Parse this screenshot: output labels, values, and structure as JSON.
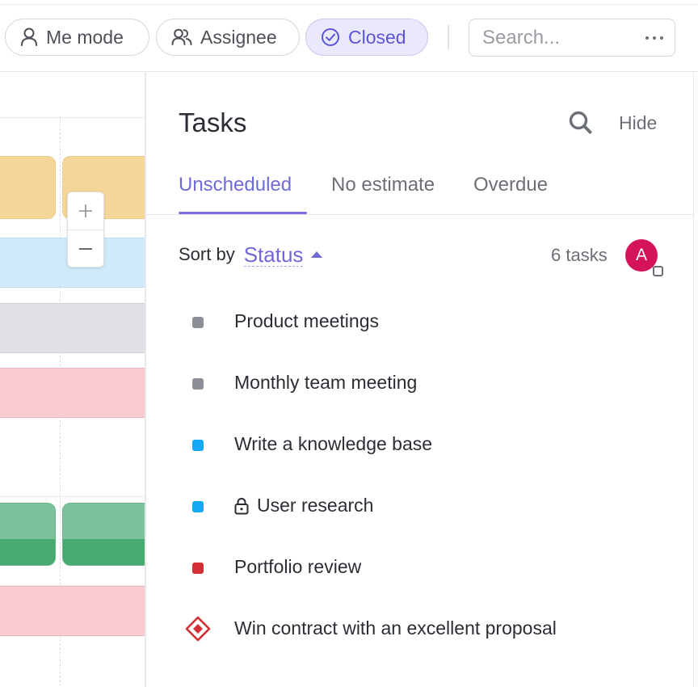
{
  "toolbar": {
    "filters": [
      {
        "label": "Me mode",
        "icon": "person-icon",
        "active": false
      },
      {
        "label": "Assignee",
        "icon": "people-icon",
        "active": false
      },
      {
        "label": "Closed",
        "icon": "check-circle-icon",
        "active": true
      }
    ],
    "search_placeholder": "Search...",
    "more_icon": "ellipsis-icon"
  },
  "zoom": {
    "in_icon": "plus-icon",
    "out_icon": "minus-icon"
  },
  "timeline": {
    "bar_colors": {
      "yellow": "#f5d69a",
      "blue": "#d0eafa",
      "gray": "#e0e1e4",
      "pink": "#f9ccd2",
      "green": "#7cc39d",
      "green_progress": "#47ab6f"
    }
  },
  "panel": {
    "title": "Tasks",
    "search_icon": "search-icon",
    "hide_label": "Hide",
    "tabs": [
      "Unscheduled",
      "No estimate",
      "Overdue"
    ],
    "active_tab": "Unscheduled",
    "sort_label": "Sort by",
    "sort_value": "Status",
    "task_count": "6 tasks",
    "avatar_initial": "A",
    "avatar_color": "#d4135b",
    "accent_color": "#7068d6",
    "tasks": [
      {
        "name": "Product meetings",
        "status_color": "#8c8f95",
        "locked": false
      },
      {
        "name": "Monthly team meeting",
        "status_color": "#8c8f95",
        "locked": false
      },
      {
        "name": "Write a knowledge base",
        "status_color": "#13aaf3",
        "locked": false
      },
      {
        "name": "User research",
        "status_color": "#13aaf3",
        "locked": true
      },
      {
        "name": "Portfolio review",
        "status_color": "#d32f35",
        "locked": false
      },
      {
        "name": "Win contract with an excellent proposal",
        "status_color": "#d32f35",
        "milestone": true,
        "locked": false
      }
    ]
  }
}
